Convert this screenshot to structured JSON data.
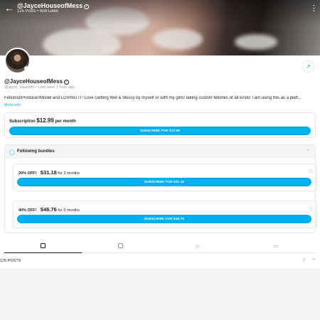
{
  "colors": {
    "accent": "#00aff0",
    "muted": "#8a96a3",
    "text": "#1b1c20"
  },
  "header": {
    "back_icon": "back-arrow-icon",
    "name": "@JayceHouseofMess",
    "posts": "125 Posts",
    "separator": "•",
    "likes": "659 Likes",
    "more_icon": "vertical-dots-icon"
  },
  "profile": {
    "name": "@JayceHouseofMess",
    "handle": "@jayce_housofm",
    "last_seen": "Last seen 1 hour ago",
    "bio": "Fetishist/Producer/Model and LOVING IT! Love Getting Wet & Messy by myself or with my girls! taking custom fetishes of all kinds! I am using this as a platf...",
    "more_info": "More info"
  },
  "subscription": {
    "label": "Subscription",
    "price": "$12.99",
    "period": "per month",
    "button": "SUBSCRIBE FOR $12.99"
  },
  "bundles": {
    "title": "Following bundles",
    "items": [
      {
        "discount": "20% OFF!",
        "price": "$31.18",
        "duration": "for 3 months",
        "button": "SUBSCRIBE FOR $31.18"
      },
      {
        "discount": "40% OFF!",
        "price": "$46.76",
        "duration": "for 6 months",
        "button": "SUBSCRIBE FOR $46.76"
      }
    ]
  },
  "tabs": [
    {
      "name": "posts",
      "icon": "posts-icon",
      "active": true
    },
    {
      "name": "photos",
      "icon": "image-icon",
      "active": false
    },
    {
      "name": "videos",
      "icon": "video-icon",
      "active": false
    },
    {
      "name": "collections",
      "icon": "folder-icon",
      "active": false
    }
  ],
  "feed": {
    "count": "125 POSTS"
  }
}
